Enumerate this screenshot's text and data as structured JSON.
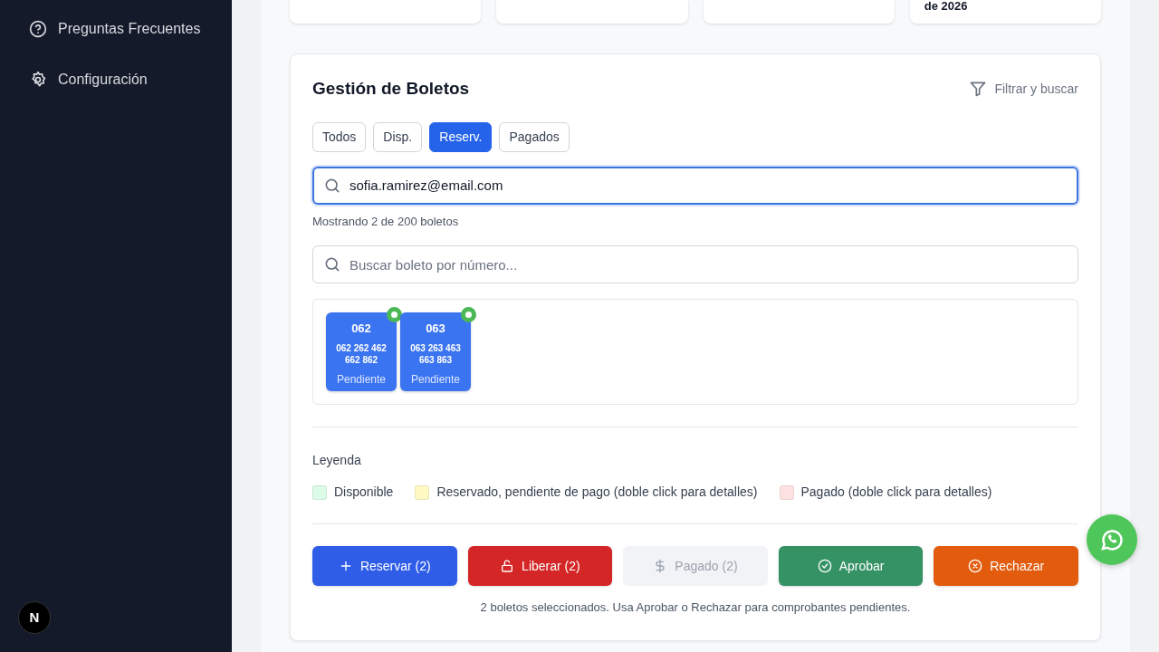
{
  "sidebar": {
    "items": [
      {
        "label": "Preguntas Frecuentes"
      },
      {
        "label": "Configuración"
      }
    ],
    "dev_badge": "N"
  },
  "stat_cards": [
    {
      "kind": "blank"
    },
    {
      "kind": "blank"
    },
    {
      "kind": "blank"
    },
    {
      "kind": "text",
      "text": "de 2026"
    }
  ],
  "tickets_panel": {
    "title": "Gestión de Boletos",
    "filter_link": "Filtrar y buscar",
    "filters": [
      {
        "label": "Todos",
        "selected": false
      },
      {
        "label": "Disp.",
        "selected": false
      },
      {
        "label": "Reserv.",
        "selected": true
      },
      {
        "label": "Pagados",
        "selected": false
      }
    ],
    "email_search": {
      "value": "sofia.ramirez@email.com"
    },
    "result_count": "Mostrando 2 de 200 boletos",
    "number_search": {
      "placeholder": "Buscar boleto por número..."
    },
    "tickets": [
      {
        "number": "062",
        "series": "062 262 462 662 862",
        "status": "Pendiente",
        "selected": true
      },
      {
        "number": "063",
        "series": "063 263 463 663 863",
        "status": "Pendiente",
        "selected": true
      }
    ],
    "legend_title": "Leyenda",
    "legend": [
      {
        "label": "Disponible",
        "color": "#dcfce7"
      },
      {
        "label": "Reservado, pendiente de pago (doble click para detalles)",
        "color": "#fef9c3"
      },
      {
        "label": "Pagado (doble click para detalles)",
        "color": "#fee2e2"
      }
    ],
    "actions": [
      {
        "label": "Reservar (2)",
        "kind": "reserve",
        "disabled": false
      },
      {
        "label": "Liberar (2)",
        "kind": "release",
        "disabled": false
      },
      {
        "label": "Pagado (2)",
        "kind": "paid",
        "disabled": true
      },
      {
        "label": "Aprobar",
        "kind": "approve",
        "disabled": false
      },
      {
        "label": "Rechazar",
        "kind": "reject",
        "disabled": false
      }
    ],
    "selection_note": "2 boletos seleccionados. Usa Aprobar o Rechazar para comprobantes pendientes."
  }
}
